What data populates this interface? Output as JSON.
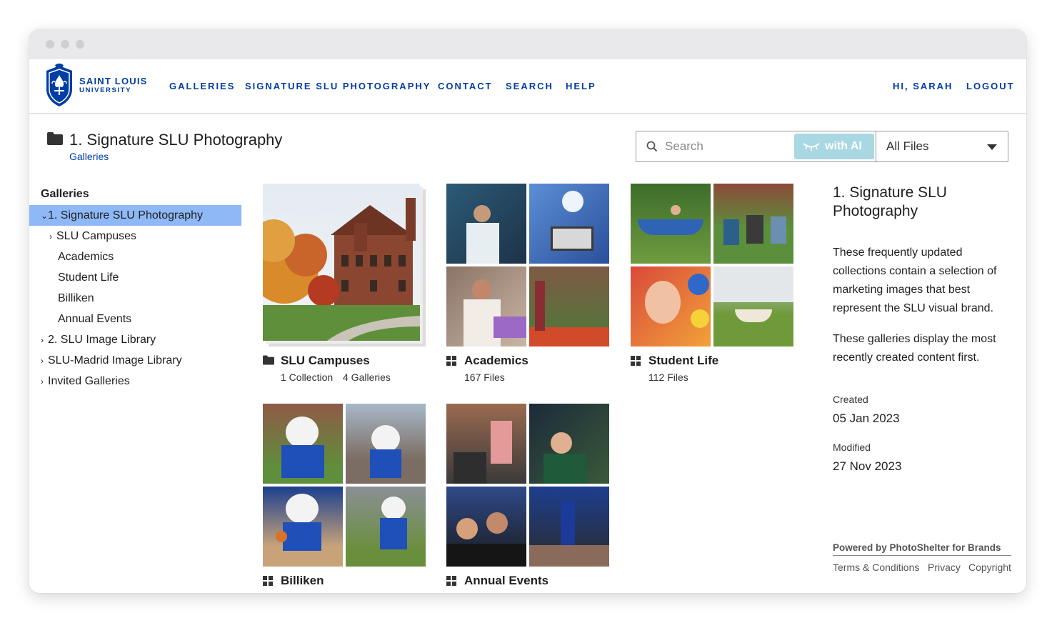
{
  "brand": {
    "line1": "SAINT LOUIS",
    "line2": "UNIVERSITY",
    "primary_color": "#003da5"
  },
  "nav": {
    "galleries": "GALLERIES",
    "signature": "SIGNATURE SLU PHOTOGRAPHY",
    "contact": "CONTACT",
    "search": "SEARCH",
    "help": "HELP",
    "greeting": "HI, SARAH",
    "logout": "LOGOUT"
  },
  "page": {
    "title": "1. Signature SLU Photography",
    "breadcrumb": "Galleries"
  },
  "search": {
    "placeholder": "Search",
    "ai_label": "with AI",
    "filter_value": "All Files"
  },
  "sidebar": {
    "title": "Galleries",
    "items": [
      {
        "label": "1. Signature SLU Photography"
      },
      {
        "label": "SLU Campuses"
      },
      {
        "label": "Academics"
      },
      {
        "label": "Student Life"
      },
      {
        "label": "Billiken"
      },
      {
        "label": "Annual Events"
      },
      {
        "label": "2. SLU Image Library"
      },
      {
        "label": "SLU-Madrid Image Library"
      },
      {
        "label": "Invited Galleries"
      }
    ]
  },
  "tiles": [
    {
      "name": "SLU Campuses",
      "meta_a": "1 Collection",
      "meta_b": "4 Galleries",
      "icon": "folder-icon"
    },
    {
      "name": "Academics",
      "meta_a": "167 Files",
      "icon": "gallery-grid-icon"
    },
    {
      "name": "Student Life",
      "meta_a": "112 Files",
      "icon": "gallery-grid-icon"
    },
    {
      "name": "Billiken",
      "icon": "gallery-grid-icon"
    },
    {
      "name": "Annual Events",
      "icon": "gallery-grid-icon"
    }
  ],
  "info": {
    "title": "1. Signature SLU Photography",
    "description_1": "These frequently updated collections contain a selection of marketing images that best represent the SLU visual brand.",
    "description_2": "These galleries display the most recently created content first.",
    "created_label": "Created",
    "created_value": "05 Jan 2023",
    "modified_label": "Modified",
    "modified_value": "27 Nov 2023"
  },
  "footer": {
    "powered": "Powered by PhotoShelter for Brands",
    "terms": "Terms & Conditions",
    "privacy": "Privacy",
    "copyright": "Copyright"
  }
}
